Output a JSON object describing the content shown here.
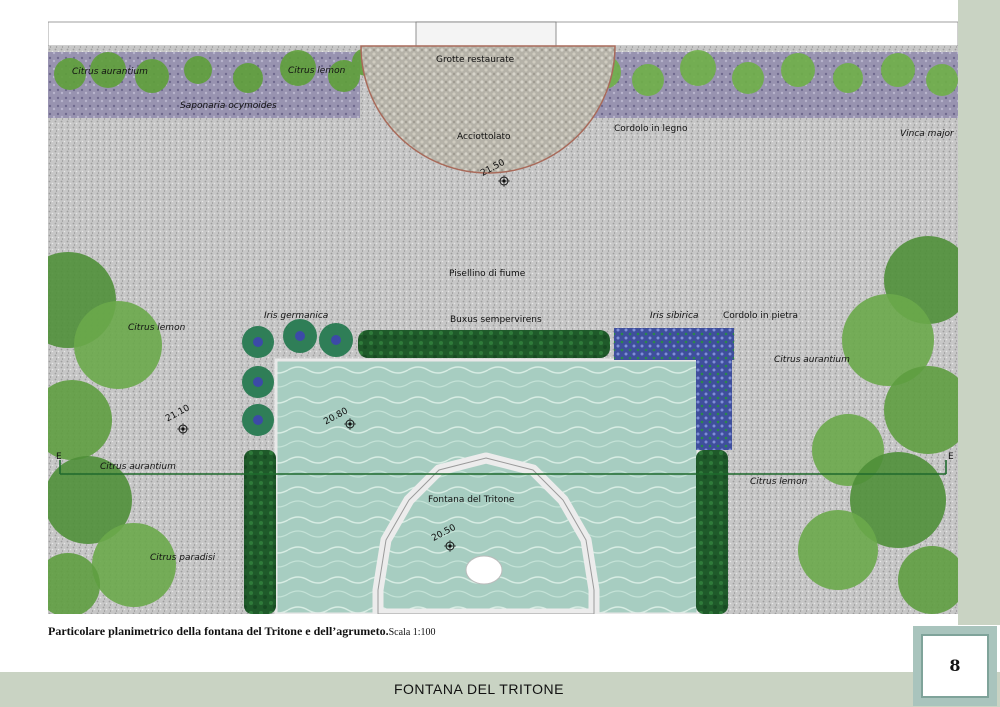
{
  "plan": {
    "labels": {
      "grotte": "Grotte restaurate",
      "citrus_aurantium_top": "Citrus aurantium",
      "citrus_lemon_top": "Citrus lemon",
      "saponaria": "Saponaria ocymoides",
      "acciottolato": "Acciottolato",
      "cordolo_legno": "Cordolo in legno",
      "vinca": "Vinca major",
      "pisellino": "Pisellino di fiume",
      "iris_germanica": "Iris germanica",
      "buxus": "Buxus sempervirens",
      "iris_sibirica": "Iris sibirica",
      "cordolo_pietra": "Cordolo in pietra",
      "citrus_lemon_left": "Citrus lemon",
      "citrus_aurantium_right": "Citrus aurantium",
      "citrus_aurantium_left": "Citrus aurantium",
      "citrus_lemon_right": "Citrus lemon",
      "citrus_paradisi": "Citrus paradisi",
      "fontana": "Fontana del Tritone",
      "section_left": "E",
      "section_right": "E"
    },
    "elevations": {
      "top": "21.50",
      "left": "21.10",
      "pool": "20.80",
      "fountain": "20.50"
    }
  },
  "caption": {
    "text": "Particolare planimetrico della fontana del Tritone e dell’agrumeto.",
    "scale": "Scala 1:100"
  },
  "footer": {
    "title": "FONTANA DEL TRITONE"
  },
  "page": {
    "number": "8"
  },
  "colors": {
    "gravel": "#c3c3c3",
    "water": "#a6ccc0",
    "hedge": "#1f5a2a",
    "foliage": "#5f9e3c",
    "lavender_bed": "#8b86a6",
    "band": "#c9d3c3",
    "badge": "#a9c4bd"
  },
  "icons": [
    "elevation-marker-icon",
    "tree-canopy-icon",
    "iris-plant-icon"
  ]
}
